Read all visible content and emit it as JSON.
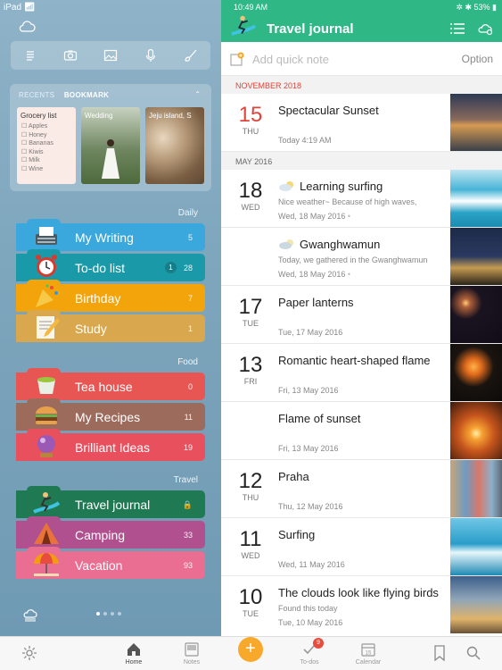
{
  "status_bar": {
    "device": "iPad",
    "time": "10:49 AM",
    "battery": "53%"
  },
  "sidebar": {
    "toolbar_icons": [
      "list-icon",
      "camera-icon",
      "image-icon",
      "microphone-icon",
      "brush-icon"
    ],
    "recent_tabs": {
      "recents": "RECENTS",
      "bookmark": "BOOKMARK"
    },
    "cards": [
      {
        "title": "Grocery list",
        "items": [
          "☐ Apples",
          "☐ Honey",
          "☐ Bananas",
          "☐ Kiwis",
          "☐ Milk",
          "☐ Wine"
        ]
      },
      {
        "title": "Wedding"
      },
      {
        "title": "Jeju island, S"
      }
    ],
    "groups": [
      {
        "label": "Daily",
        "journals": [
          {
            "name": "My Writing",
            "count": "5",
            "color": "#3aa8dc",
            "icon": "typewriter-icon"
          },
          {
            "name": "To-do list",
            "count": "28",
            "badge": "1",
            "color": "#1a9aa8",
            "icon": "alarm-clock-icon"
          },
          {
            "name": "Birthday",
            "count": "7",
            "color": "#f2a40a",
            "icon": "party-icon"
          },
          {
            "name": "Study",
            "count": "1",
            "color": "#d9a84e",
            "icon": "memo-icon"
          }
        ]
      },
      {
        "label": "Food",
        "journals": [
          {
            "name": "Tea house",
            "count": "0",
            "color": "#e85654",
            "icon": "tea-icon"
          },
          {
            "name": "My Recipes",
            "count": "11",
            "color": "#9c6b5b",
            "icon": "burger-icon"
          },
          {
            "name": "Brilliant Ideas",
            "count": "19",
            "color": "#e8505e",
            "icon": "crystal-ball-icon"
          }
        ]
      },
      {
        "label": "Travel",
        "journals": [
          {
            "name": "Travel journal",
            "count": "🔒",
            "color": "#1f7a53",
            "icon": "surfer-icon"
          },
          {
            "name": "Camping",
            "count": "33",
            "color": "#b0508f",
            "icon": "tent-icon"
          },
          {
            "name": "Vacation",
            "count": "93",
            "color": "#ea6d92",
            "icon": "umbrella-icon"
          }
        ]
      }
    ]
  },
  "journal": {
    "title": "Travel journal",
    "quick_placeholder": "Add quick note",
    "option_label": "Option",
    "months": [
      "NOVEMBER 2018",
      "MAY 2016"
    ],
    "entries": [
      {
        "day": "15",
        "weekday": "THU",
        "title": "Spectacular Sunset",
        "subtitle": "",
        "date": "Today 4:19 AM",
        "red": true
      },
      {
        "day": "18",
        "weekday": "WED",
        "title": "Learning surfing",
        "subtitle": "Nice weather~ Because of high waves,",
        "date": "Wed, 18 May 2016",
        "weather": true
      },
      {
        "day": "",
        "weekday": "",
        "title": "Gwanghwamun",
        "subtitle": "Today, we gathered in the Gwanghwamun",
        "date": "Wed, 18 May 2016",
        "weather": true
      },
      {
        "day": "17",
        "weekday": "TUE",
        "title": "Paper lanterns",
        "subtitle": "",
        "date": "Tue, 17 May 2016"
      },
      {
        "day": "13",
        "weekday": "FRI",
        "title": "Romantic heart-shaped flame",
        "subtitle": "",
        "date": "Fri, 13 May 2016"
      },
      {
        "day": "",
        "weekday": "",
        "title": "Flame of sunset",
        "subtitle": "",
        "date": "Fri, 13 May 2016"
      },
      {
        "day": "12",
        "weekday": "THU",
        "title": "Praha",
        "subtitle": "",
        "date": "Thu, 12 May 2016"
      },
      {
        "day": "11",
        "weekday": "WED",
        "title": "Surfing",
        "subtitle": "",
        "date": "Wed, 11 May 2016"
      },
      {
        "day": "10",
        "weekday": "TUE",
        "title": "The clouds look like flying birds",
        "subtitle": "Found this today",
        "date": "Tue, 10 May 2016"
      }
    ]
  },
  "bottom_nav": {
    "home": "Home",
    "notes": "Notes",
    "todos": "To-dos",
    "todos_badge": "9",
    "calendar": "Calendar",
    "add": "+"
  }
}
